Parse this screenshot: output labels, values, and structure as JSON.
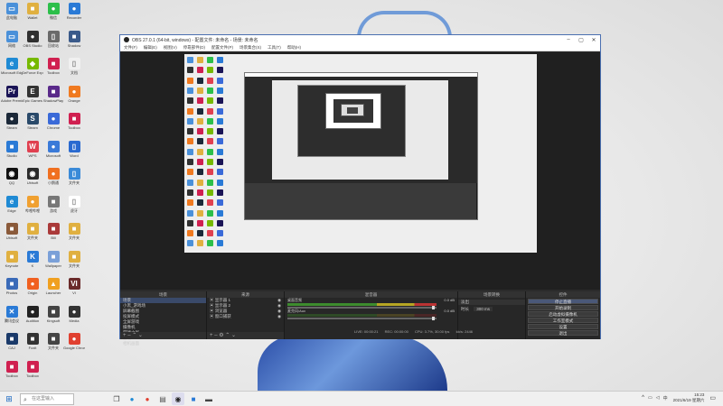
{
  "obs": {
    "title": "OBS 27.0.1 (64-bit, windows) - 配置文件: 未命名 - 场景: 未命名",
    "menu": [
      "文件(F)",
      "编辑(E)",
      "视图(V)",
      "停靠部件(D)",
      "配置文件(P)",
      "场景集合(S)",
      "工具(T)",
      "帮助(H)"
    ],
    "docks": {
      "scenes": {
        "header": "场景",
        "items": [
          "场景",
          "小黑_游戏场",
          "屏幕截图",
          "投屏模式",
          "全屏游戏",
          "摄像机",
          "游戏之屏",
          "游戏",
          "相机画面"
        ],
        "selected": 0
      },
      "sources": {
        "header": "来源",
        "items": [
          "显示器 1",
          "显示器 2",
          "浏览器",
          "窗口捕获"
        ]
      },
      "mixer": {
        "header": "混音器",
        "channels": [
          {
            "name": "桌面音频",
            "db": "0.0 dB"
          },
          {
            "name": "麦克风/Aux",
            "db": "0.0 dB"
          }
        ]
      },
      "transitions": {
        "header": "场景转换",
        "type": "淡出",
        "duration_label": "时长",
        "duration": "300 ms"
      },
      "controls": {
        "header": "控件",
        "buttons": [
          "停止直播",
          "开始录制",
          "启动虚拟摄像机",
          "工作室模式",
          "设置",
          "退出"
        ],
        "active": 0
      }
    },
    "status": {
      "live_label": "LIVE: 00:00:21",
      "rec_label": "REC: 00:00:00",
      "cpu": "CPU: 3.7%, 30.00 fps",
      "kbps": "kb/s: 2446"
    },
    "no_source_hint": "未选择源"
  },
  "desktop": {
    "icons": [
      {
        "label": "此电脑",
        "color": "#4a90d9",
        "glyph": "▭"
      },
      {
        "label": "Wallet",
        "color": "#e0b040",
        "glyph": "■"
      },
      {
        "label": "微信",
        "color": "#2cbf4a",
        "glyph": "●"
      },
      {
        "label": "Recorder",
        "color": "#2a7ad6",
        "glyph": "●"
      },
      {
        "label": "网络",
        "color": "#4a90d9",
        "glyph": "▭"
      },
      {
        "label": "OBS Studio",
        "color": "#303030",
        "glyph": "●"
      },
      {
        "label": "回收站",
        "color": "#6a6a6a",
        "glyph": "▯"
      },
      {
        "label": "Shadow",
        "color": "#3a5a8a",
        "glyph": "■"
      },
      {
        "label": "Microsoft Edge",
        "color": "#1f8ad4",
        "glyph": "e"
      },
      {
        "label": "GeForce Experience",
        "color": "#76b900",
        "glyph": "◆"
      },
      {
        "label": "Toolbox",
        "color": "#d02050",
        "glyph": "■"
      },
      {
        "label": "文档",
        "color": "#f0f0f0",
        "glyph": "▯"
      },
      {
        "label": "Adobe Premiere",
        "color": "#1a1456",
        "glyph": "Pr"
      },
      {
        "label": "Epic Games",
        "color": "#333333",
        "glyph": "E"
      },
      {
        "label": "ShadowPlay",
        "color": "#5a2a8a",
        "glyph": "■"
      },
      {
        "label": "Orange",
        "color": "#f07a20",
        "glyph": "●"
      },
      {
        "label": "Steam",
        "color": "#1b2838",
        "glyph": "●"
      },
      {
        "label": "Steam",
        "color": "#2a4a6a",
        "glyph": "S"
      },
      {
        "label": "Chrome",
        "color": "#3a6ad8",
        "glyph": "●"
      },
      {
        "label": "Toolbox",
        "color": "#d02050",
        "glyph": "■"
      },
      {
        "label": "Studio",
        "color": "#2a7ad6",
        "glyph": "■"
      },
      {
        "label": "WPS",
        "color": "#e04050",
        "glyph": "W"
      },
      {
        "label": "Microsoft",
        "color": "#3a7ad8",
        "glyph": "●"
      },
      {
        "label": "Word",
        "color": "#2a6ad0",
        "glyph": "▯"
      },
      {
        "label": "QQ",
        "color": "#111111",
        "glyph": "◉"
      },
      {
        "label": "Ubisoft",
        "color": "#2a2a2a",
        "glyph": "◉"
      },
      {
        "label": "小鹅通",
        "color": "#f07020",
        "glyph": "●"
      },
      {
        "label": "文件夹",
        "color": "#3a8ad8",
        "glyph": "▯"
      },
      {
        "label": "Edge",
        "color": "#1f8ad4",
        "glyph": "e"
      },
      {
        "label": "哔哩哔哩",
        "color": "#f0a030",
        "glyph": "●"
      },
      {
        "label": "游戏",
        "color": "#777777",
        "glyph": "■"
      },
      {
        "label": "虎牙",
        "color": "#ffffff",
        "glyph": "▯"
      },
      {
        "label": "Ubisoft",
        "color": "#8a5a3a",
        "glyph": "■"
      },
      {
        "label": "文件夹",
        "color": "#e0b040",
        "glyph": "■"
      },
      {
        "label": "Bili",
        "color": "#aa3a3a",
        "glyph": "■"
      },
      {
        "label": "文件夹",
        "color": "#e0b040",
        "glyph": "■"
      },
      {
        "label": "Keynote",
        "color": "#e0b040",
        "glyph": "■"
      },
      {
        "label": "K",
        "color": "#2a7ad6",
        "glyph": "K"
      },
      {
        "label": "Wallpaper",
        "color": "#7aa0d8",
        "glyph": "■"
      },
      {
        "label": "文件夹",
        "color": "#e0b040",
        "glyph": "■"
      },
      {
        "label": "Photos",
        "color": "#3a6ab8",
        "glyph": "■"
      },
      {
        "label": "Origin",
        "color": "#f06020",
        "glyph": "●"
      },
      {
        "label": "Launcher",
        "color": "#f0a020",
        "glyph": "▲"
      },
      {
        "label": "VI",
        "color": "#6a2a2a",
        "glyph": "VI"
      },
      {
        "label": "腾讯会议",
        "color": "#2a7ad6",
        "glyph": "✕"
      },
      {
        "label": "Audition",
        "color": "#222222",
        "glyph": "●"
      },
      {
        "label": "Kingsoft",
        "color": "#444444",
        "glyph": "■"
      },
      {
        "label": "Media",
        "color": "#333333",
        "glyph": "●"
      },
      {
        "label": "CAJ",
        "color": "#1a3a6a",
        "glyph": "■"
      },
      {
        "label": "Foxit",
        "color": "#333333",
        "glyph": "■"
      },
      {
        "label": "文件夹",
        "color": "#444444",
        "glyph": "■"
      },
      {
        "label": "Google Chrome",
        "color": "#e04030",
        "glyph": "●"
      },
      {
        "label": "Toolbox",
        "color": "#d02050",
        "glyph": "■"
      },
      {
        "label": "Toolbox",
        "color": "#d02050",
        "glyph": "■"
      }
    ]
  },
  "taskbar": {
    "search_placeholder": "在这里输入",
    "time": "15:23",
    "date": "2021/6/19 星期六",
    "lang": "中"
  }
}
